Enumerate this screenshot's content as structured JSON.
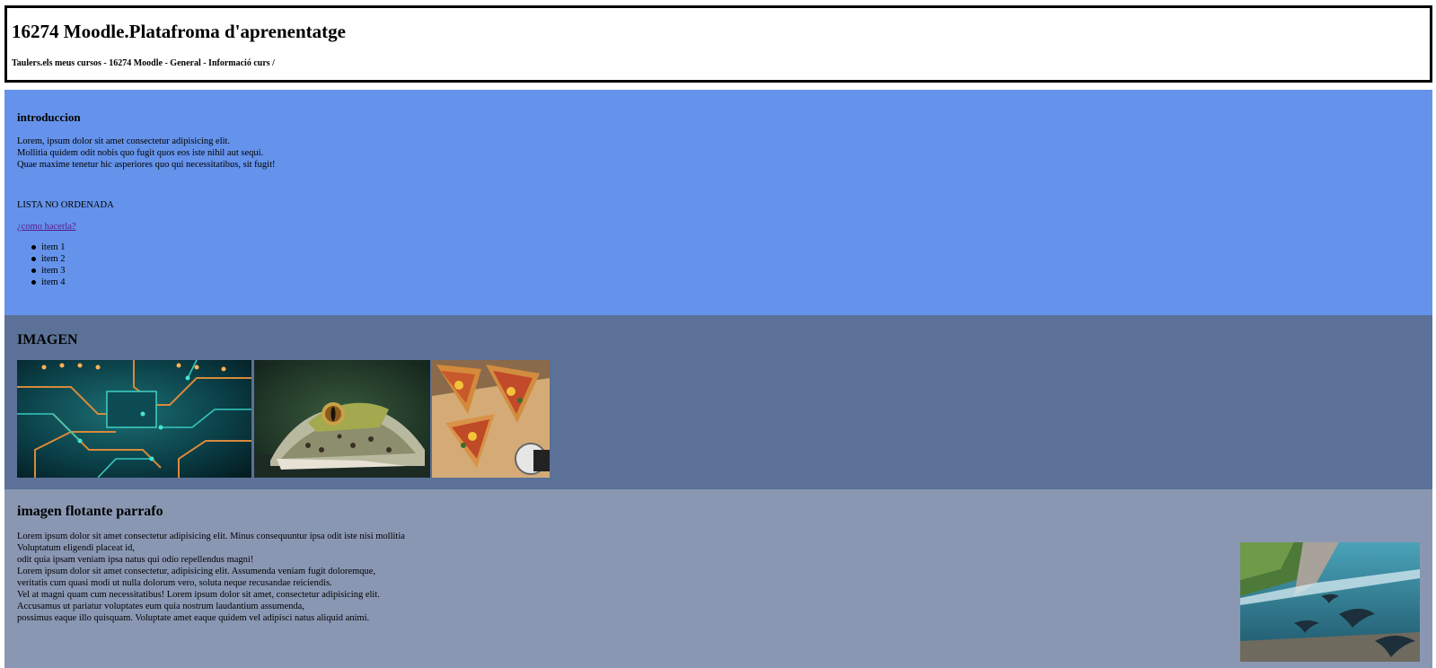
{
  "header": {
    "title": "16274 Moodle.Platafroma d'aprenentatge",
    "breadcrumb": "Taulers.els meus cursos - 16274 Moodle - General - Informació curs /"
  },
  "intro": {
    "heading": "introduccion",
    "paragraph_lines": [
      "Lorem, ipsum dolor sit amet consectetur adipisicing elit.",
      "Mollitia quidem odit nobis quo fugit quos eos iste nihil aut sequi.",
      "Quae maxime tenetur hic asperiores quo qui necessitatibus, sit fugit!"
    ],
    "list_title": "LISTA NO ORDENADA",
    "link_text": "¿como hacerla?",
    "items": [
      "item 1",
      "item 2",
      "item 3",
      "item 4"
    ]
  },
  "imagen": {
    "heading": "IMAGEN",
    "images": [
      "circuit-board-image",
      "crocodile-image",
      "pizza-image"
    ]
  },
  "float": {
    "heading": "imagen flotante parrafo",
    "paragraph_lines": [
      "Lorem ipsum dolor sit amet consectetur adipisicing elit. Minus consequuntur ipsa odit iste nisi mollitia",
      "Voluptatum eligendi placeat id,",
      "odit quia ipsam veniam ipsa natus qui odio repellendus magni!",
      "Lorem ipsum dolor sit amet consectetur, adipisicing elit. Assumenda veniam fugit doloremque,",
      "veritatis cum quasi modi ut nulla dolorum vero, soluta neque recusandae reiciendis.",
      "Vel at magni quam cum necessitatibus! Lorem ipsum dolor sit amet, consectetur adipisicing elit.",
      "Accusamus ut pariatur voluptates eum quia nostrum laudantium assumenda,",
      "possimus eaque illo quisquam. Voluptate amet eaque quidem vel adipisci natus aliquid animi."
    ],
    "image": "manta-ray-image"
  },
  "colors": {
    "intro_bg": "#6593EB",
    "imagen_bg": "#5B7197",
    "float_bg": "#8A97B3",
    "link": "#551A8B"
  }
}
